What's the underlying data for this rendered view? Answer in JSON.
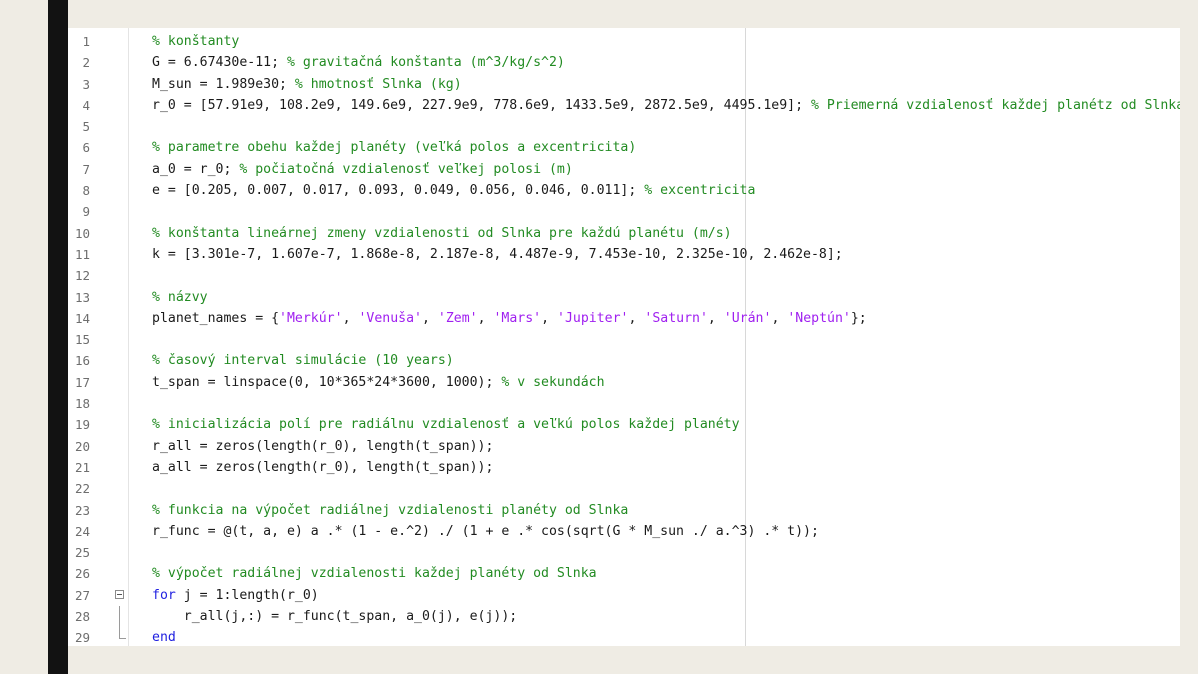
{
  "editor": {
    "lines": [
      [
        {
          "t": "c",
          "v": "% konštanty"
        }
      ],
      [
        {
          "t": "t",
          "v": "G = 6.67430e-11; "
        },
        {
          "t": "c",
          "v": "% gravitačná konštanta (m^3/kg/s^2)"
        }
      ],
      [
        {
          "t": "t",
          "v": "M_sun = 1.989e30; "
        },
        {
          "t": "c",
          "v": "% hmotnosť Slnka (kg)"
        }
      ],
      [
        {
          "t": "t",
          "v": "r_0 = [57.91e9, 108.2e9, 149.6e9, 227.9e9, 778.6e9, 1433.5e9, 2872.5e9, 4495.1e9]; "
        },
        {
          "t": "c",
          "v": "% Priemerná vzdialenosť každej planétz od Slnka"
        }
      ],
      [],
      [
        {
          "t": "c",
          "v": "% parametre obehu každej planéty (veľká polos a excentricita)"
        }
      ],
      [
        {
          "t": "t",
          "v": "a_0 = r_0; "
        },
        {
          "t": "c",
          "v": "% počiatočná vzdialenosť veľkej polosi (m)"
        }
      ],
      [
        {
          "t": "t",
          "v": "e = [0.205, 0.007, 0.017, 0.093, 0.049, 0.056, 0.046, 0.011]; "
        },
        {
          "t": "c",
          "v": "% excentricita"
        }
      ],
      [],
      [
        {
          "t": "c",
          "v": "% konštanta lineárnej zmeny vzdialenosti od Slnka pre každú planétu (m/s)"
        }
      ],
      [
        {
          "t": "t",
          "v": "k = [3.301e-7, 1.607e-7, 1.868e-8, 2.187e-8, 4.487e-9, 7.453e-10, 2.325e-10, 2.462e-8];"
        }
      ],
      [],
      [
        {
          "t": "c",
          "v": "% názvy"
        }
      ],
      [
        {
          "t": "t",
          "v": "planet_names = {"
        },
        {
          "t": "s",
          "v": "'Merkúr'"
        },
        {
          "t": "t",
          "v": ", "
        },
        {
          "t": "s",
          "v": "'Venuša'"
        },
        {
          "t": "t",
          "v": ", "
        },
        {
          "t": "s",
          "v": "'Zem'"
        },
        {
          "t": "t",
          "v": ", "
        },
        {
          "t": "s",
          "v": "'Mars'"
        },
        {
          "t": "t",
          "v": ", "
        },
        {
          "t": "s",
          "v": "'Jupiter'"
        },
        {
          "t": "t",
          "v": ", "
        },
        {
          "t": "s",
          "v": "'Saturn'"
        },
        {
          "t": "t",
          "v": ", "
        },
        {
          "t": "s",
          "v": "'Urán'"
        },
        {
          "t": "t",
          "v": ", "
        },
        {
          "t": "s",
          "v": "'Neptún'"
        },
        {
          "t": "t",
          "v": "};"
        }
      ],
      [],
      [
        {
          "t": "c",
          "v": "% časový interval simulácie (10 years)"
        }
      ],
      [
        {
          "t": "t",
          "v": "t_span = linspace(0, 10*365*24*3600, 1000); "
        },
        {
          "t": "c",
          "v": "% v sekundách"
        }
      ],
      [],
      [
        {
          "t": "c",
          "v": "% inicializácia polí pre radiálnu vzdialenosť a veľkú polos každej planéty"
        }
      ],
      [
        {
          "t": "t",
          "v": "r_all = zeros(length(r_0), length(t_span));"
        }
      ],
      [
        {
          "t": "t",
          "v": "a_all = zeros(length(r_0), length(t_span));"
        }
      ],
      [],
      [
        {
          "t": "c",
          "v": "% funkcia na výpočet radiálnej vzdialenosti planéty od Slnka"
        }
      ],
      [
        {
          "t": "t",
          "v": "r_func = @(t, a, e) a .* (1 - e.^2) ./ (1 + e .* cos(sqrt(G * M_sun ./ a.^3) .* t));"
        }
      ],
      [],
      [
        {
          "t": "c",
          "v": "% výpočet radiálnej vzdialenosti každej planéty od Slnka"
        }
      ],
      [
        {
          "t": "k",
          "v": "for"
        },
        {
          "t": "t",
          "v": " j = 1:length(r_0)"
        }
      ],
      [
        {
          "t": "t",
          "v": "    r_all(j,:) = r_func(t_span, a_0(j), e(j));"
        }
      ],
      [
        {
          "t": "k",
          "v": "end"
        }
      ]
    ]
  }
}
